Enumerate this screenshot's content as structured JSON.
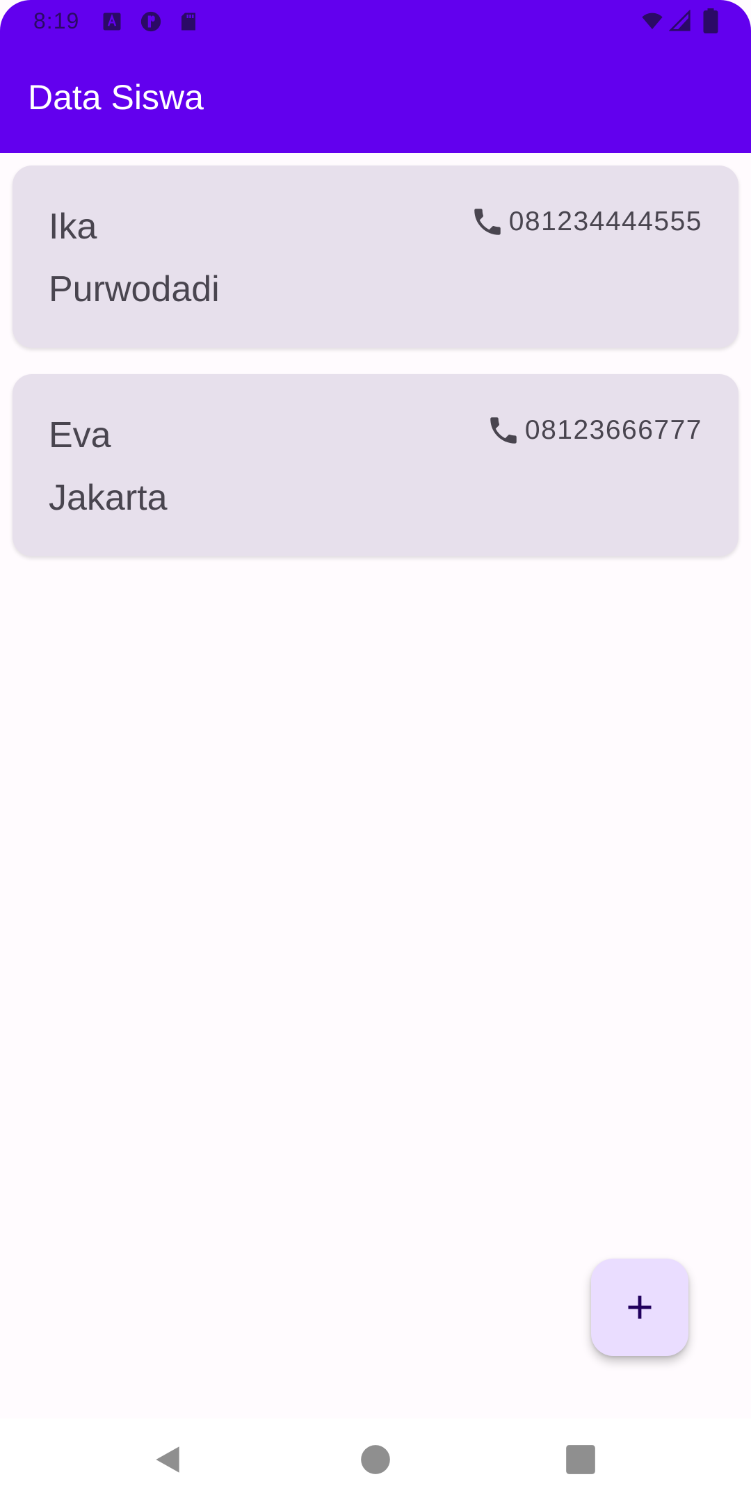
{
  "status_bar": {
    "time": "8:19",
    "left_icons": [
      "font-a-icon",
      "game-controller-icon",
      "sd-card-icon"
    ],
    "right_icons": [
      "wifi-icon",
      "cell-signal-icon",
      "battery-icon"
    ]
  },
  "app_bar": {
    "title": "Data Siswa",
    "color": "#6200ee"
  },
  "students": [
    {
      "name": "Ika",
      "city": "Purwodadi",
      "phone": "081234444555",
      "icon": "phone-icon"
    },
    {
      "name": "Eva",
      "city": "Jakarta",
      "phone": "08123666777",
      "icon": "phone-icon"
    }
  ],
  "fab": {
    "icon": "add-icon",
    "color": "#eaddff"
  },
  "nav_bar": {
    "buttons": [
      "back-icon",
      "home-icon",
      "recents-icon"
    ]
  },
  "colors": {
    "background": "#fffbfe",
    "card": "#e7e0ec",
    "text": "#49454f"
  }
}
